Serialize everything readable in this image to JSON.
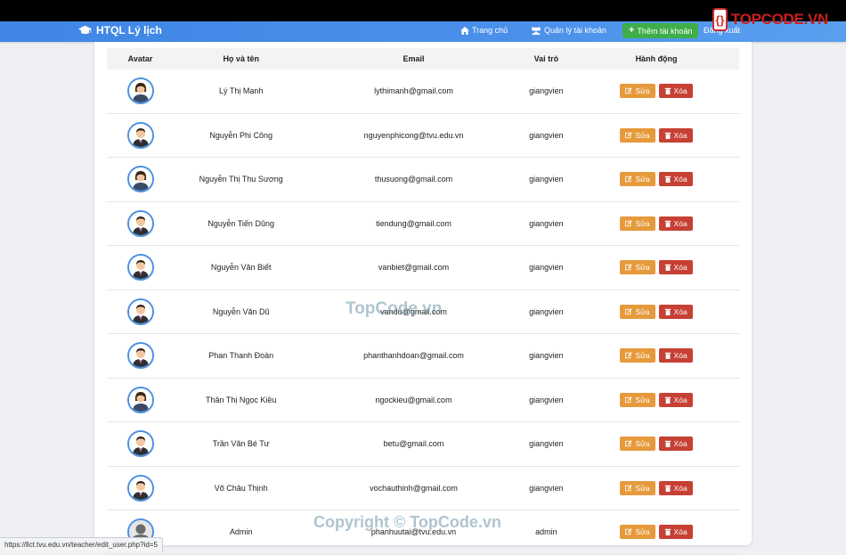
{
  "navbar": {
    "brand": "HTQL Lý lịch",
    "home": "Trang chủ",
    "accounts": "Quản lý tài khoản",
    "add_account": "Thêm tài khoản",
    "logout": "Đăng xuất"
  },
  "logo": {
    "text": "TOPCODE.VN"
  },
  "table": {
    "headers": [
      "Avatar",
      "Họ và tên",
      "Email",
      "Vai trò",
      "Hành động"
    ],
    "edit_label": "Sửa",
    "delete_label": "Xóa",
    "rows": [
      {
        "name": "Lý Thị Mạnh",
        "email": "lythimanh@gmail.com",
        "role": "giangvien",
        "avatar": "female"
      },
      {
        "name": "Nguyễn Phi Công",
        "email": "nguyenphicong@tvu.edu.vn",
        "role": "giangvien",
        "avatar": "male"
      },
      {
        "name": "Nguyễn Thị Thu Sương",
        "email": "thusuong@gmail.com",
        "role": "giangvien",
        "avatar": "female"
      },
      {
        "name": "Nguyễn Tiến Dũng",
        "email": "tiendung@gmail.com",
        "role": "giangvien",
        "avatar": "male"
      },
      {
        "name": "Nguyễn Văn Biết",
        "email": "vanbiet@gmail.com",
        "role": "giangvien",
        "avatar": "male"
      },
      {
        "name": "Nguyễn Văn Dũ",
        "email": "vandu@gmail.com",
        "role": "giangvien",
        "avatar": "male"
      },
      {
        "name": "Phan Thanh Đoàn",
        "email": "phanthanhdoan@gmail.com",
        "role": "giangvien",
        "avatar": "male"
      },
      {
        "name": "Thân Thị Ngọc Kiều",
        "email": "ngockieu@gmail.com",
        "role": "giangvien",
        "avatar": "female"
      },
      {
        "name": "Trần Văn Bé Tư",
        "email": "betu@gmail.com",
        "role": "giangvien",
        "avatar": "male"
      },
      {
        "name": "Võ Châu Thịnh",
        "email": "vochauthinh@gmail.com",
        "role": "giangvien",
        "avatar": "male"
      },
      {
        "name": "Admin",
        "email": "phanhuutai@tvu.edu.vn",
        "role": "admin",
        "avatar": "default"
      }
    ]
  },
  "watermark": {
    "center": "TopCode.vn",
    "bottom": "Copyright © TopCode.vn"
  },
  "statusbar": {
    "url": "https://llct.tvu.edu.vn/teacher/edit_user.php?id=5"
  },
  "colors": {
    "navbar": "#4a90ea",
    "add_button": "#3fae49",
    "edit_button": "#e69a3c",
    "delete_button": "#c64034"
  }
}
